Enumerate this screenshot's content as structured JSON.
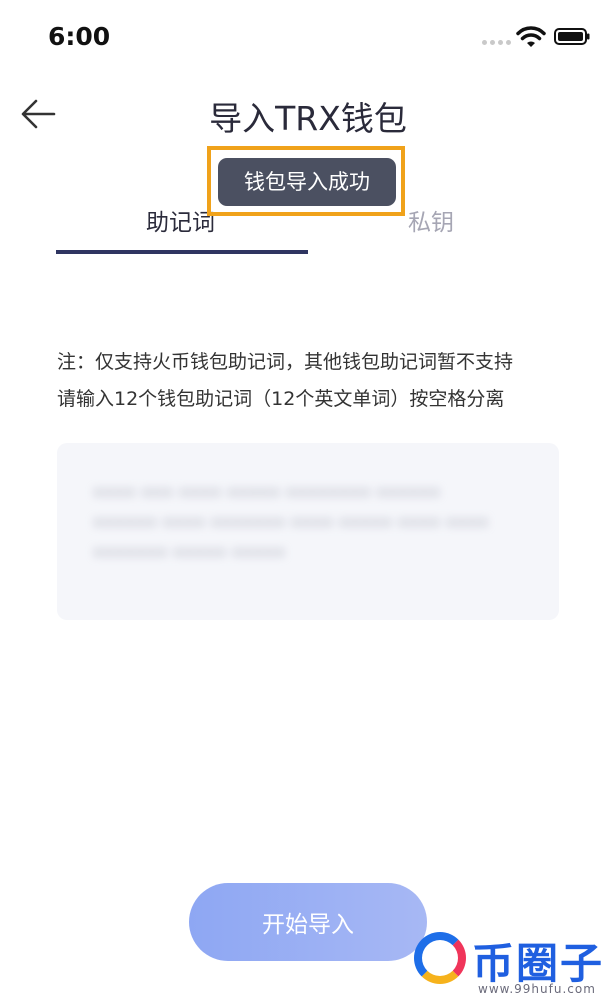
{
  "status_bar": {
    "time": "6:00"
  },
  "header": {
    "title": "导入TRX钱包",
    "back_icon": "arrow-left-icon"
  },
  "toast": {
    "message": "钱包导入成功",
    "highlight_color": "#f0a21a"
  },
  "tabs": [
    {
      "label": "助记词",
      "active": true
    },
    {
      "label": "私钥",
      "active": false
    }
  ],
  "notes": {
    "line1": "注：仅支持火币钱包助记词，其他钱包助记词暂不支持",
    "line2": "请输入12个钱包助记词（12个英文单词）按空格分离"
  },
  "mnemonic_input": {
    "value": "•••• ••• •••• ••••• •••••••• •••••• •••••• •••• ••••••• •••• ••••• •••• •••• ••••••• ••••• •••••"
  },
  "import_button": {
    "label": "开始导入"
  },
  "watermark": {
    "text": "币圈子",
    "url": "www.99hufu.com"
  },
  "colors": {
    "accent": "#2f3561",
    "button": "#8ea7f3",
    "toast_bg": "#4b5061"
  }
}
